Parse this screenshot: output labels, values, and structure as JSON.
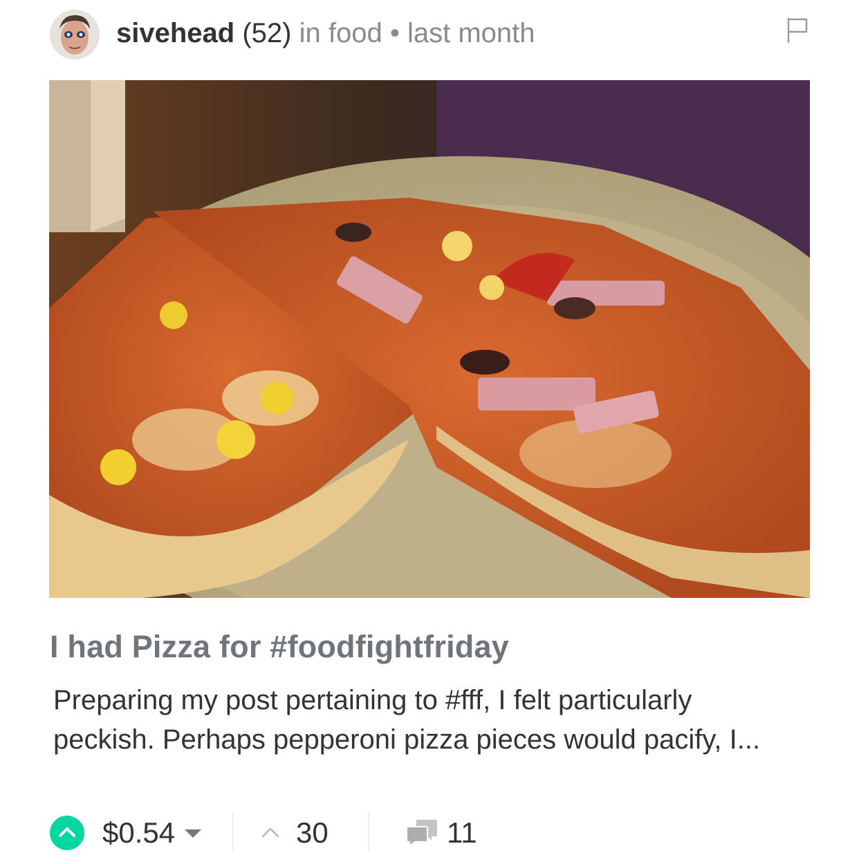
{
  "post": {
    "author": "sivehead",
    "reputation": "(52)",
    "category_text": "in food",
    "separator": "•",
    "time": "last month",
    "image_description_icon": "pizza-photo",
    "title": "I had Pizza for #foodfightfriday",
    "excerpt": "Preparing my post pertaining to #fff, I felt particularly peckish. Perhaps pepperoni pizza pieces would pacify, I..."
  },
  "footer": {
    "payout": "$0.54",
    "votes": "30",
    "comments": "11"
  },
  "colors": {
    "accent": "#07d6a0",
    "title_gray": "#6f757b",
    "muted_text": "#8a8a8a"
  },
  "icons": {
    "flag": "flag-icon",
    "vote": "chevron-up-icon",
    "payout_menu": "caret-down-icon",
    "votes": "up-arrow-icon",
    "comments": "comments-icon"
  }
}
